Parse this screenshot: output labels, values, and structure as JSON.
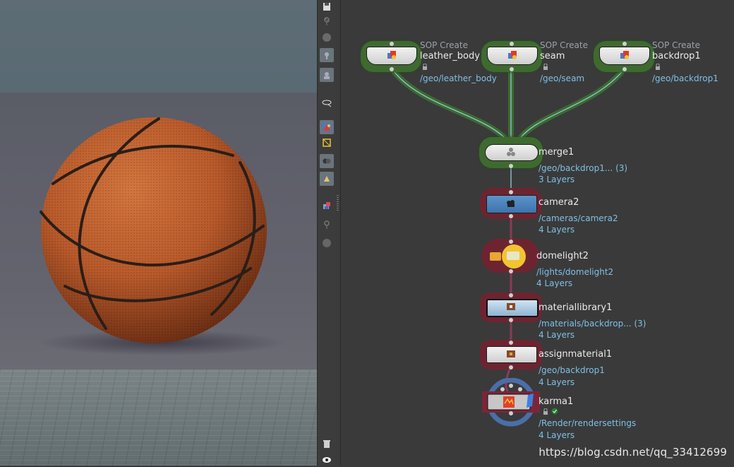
{
  "viewport": {
    "icon_names": [
      "basketball",
      "floor-grid"
    ],
    "colors": {
      "ball": "#b95a2b",
      "seams": "#2a1e18",
      "floor": "#6f7b7e",
      "background": "#5e6168"
    }
  },
  "toolbar": {
    "icon_names": [
      "save-icon",
      "snap-off-icon",
      "display-icon",
      "select-icon",
      "camera-view-icon",
      "handle-icon",
      "color-icon",
      "select-geometry-icon",
      "lasso-icon",
      "ghost-icon",
      "render-region-icon",
      "snap-icon",
      "record-icon",
      "trash-icon",
      "eye-icon"
    ]
  },
  "network": {
    "nodes": {
      "leather_body": {
        "sub": "SOP Create",
        "name": "leather_body",
        "path": "/geo/leather_body"
      },
      "seam": {
        "sub": "SOP Create",
        "name": "seam",
        "path": "/geo/seam"
      },
      "backdrop1": {
        "sub": "SOP Create",
        "name": "backdrop1",
        "path": "/geo/backdrop1"
      },
      "merge1": {
        "name": "merge1",
        "path": "/geo/backdrop1... (3)",
        "layers": "3 Layers"
      },
      "camera2": {
        "name": "camera2",
        "path": "/cameras/camera2",
        "layers": "4 Layers"
      },
      "domelight2": {
        "name": "domelight2",
        "path": "/lights/domelight2",
        "layers": "4 Layers"
      },
      "materiallibrary1": {
        "name": "materiallibrary1",
        "path": "/materials/backdrop... (3)",
        "layers": "4 Layers"
      },
      "assignmaterial1": {
        "name": "assignmaterial1",
        "path": "/geo/backdrop1",
        "layers": "4 Layers"
      },
      "karma1": {
        "name": "karma1",
        "path": "/Render/rendersettings",
        "layers": "4 Layers"
      }
    },
    "colors": {
      "wire_green": "#5a8f4a",
      "wire_red": "#8a3a55",
      "path_text": "#7ec0e6",
      "halo_green": "#3e6a30",
      "halo_red": "#6e2430"
    }
  },
  "watermark": "https://blog.csdn.net/qq_33412699"
}
